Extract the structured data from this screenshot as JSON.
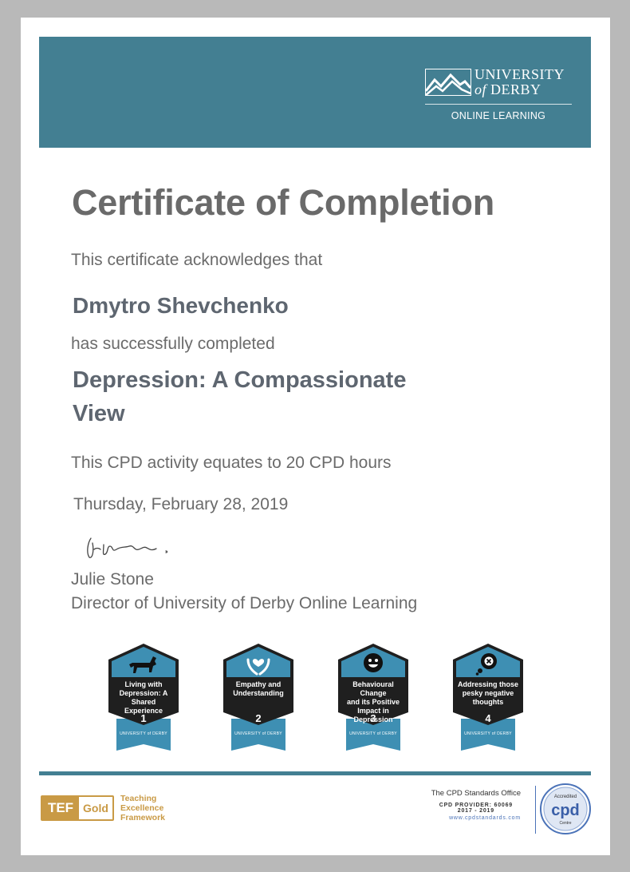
{
  "logo": {
    "university": "UNIVERSITY",
    "of": "of",
    "derby": "DERBY",
    "online": "ONLINE LEARNING"
  },
  "certificate": {
    "title": "Certificate of Completion",
    "acknowledges": "This certificate acknowledges that",
    "recipient": "Dmytro Shevchenko",
    "completed": "has successfully completed",
    "course_line1": "Depression: A Compassionate",
    "course_line2": "View",
    "cpd": "This CPD activity equates to 20 CPD hours",
    "date": "Thursday, February 28, 2019",
    "signatory_name": "Julie Stone",
    "signatory_title": "Director of University of Derby Online Learning"
  },
  "badges": [
    {
      "line1": "Living with",
      "line2": "Depression: A",
      "line3": "Shared Experience",
      "number": "1",
      "icon": "dog-icon",
      "mark": "UNIVERSITY of DERBY"
    },
    {
      "line1": "Empathy and",
      "line2": "Understanding",
      "line3": "",
      "number": "2",
      "icon": "heart-hands-icon",
      "mark": "UNIVERSITY of DERBY"
    },
    {
      "line1": "Behavioural Change",
      "line2": "and its Positive",
      "line3": "Impact in Depression",
      "number": "3",
      "icon": "smiley-icon",
      "mark": "UNIVERSITY of DERBY"
    },
    {
      "line1": "Addressing those",
      "line2": "pesky negative",
      "line3": "thoughts",
      "number": "4",
      "icon": "thought-cross-icon",
      "mark": "UNIVERSITY of DERBY"
    }
  ],
  "footer": {
    "tef_1": "TEF",
    "tef_2": "Gold",
    "tef_fw1": "Teaching",
    "tef_fw2": "Excellence",
    "tef_fw3": "Framework",
    "cpd_office": "The CPD Standards Office",
    "cpd_provider": "CPD PROVIDER: 60069",
    "cpd_years": "2017 - 2019",
    "cpd_url": "www.cpdstandards.com",
    "cpd_logo_top": "Accredited",
    "cpd_logo_main": "cpd",
    "cpd_logo_bottom": "Centre"
  },
  "colors": {
    "banner": "#437f92",
    "badge_dark": "#1f1f1f",
    "badge_blue": "#3e8fb3",
    "tef_gold": "#c99a45",
    "cpd_blue": "#4b73b8"
  }
}
